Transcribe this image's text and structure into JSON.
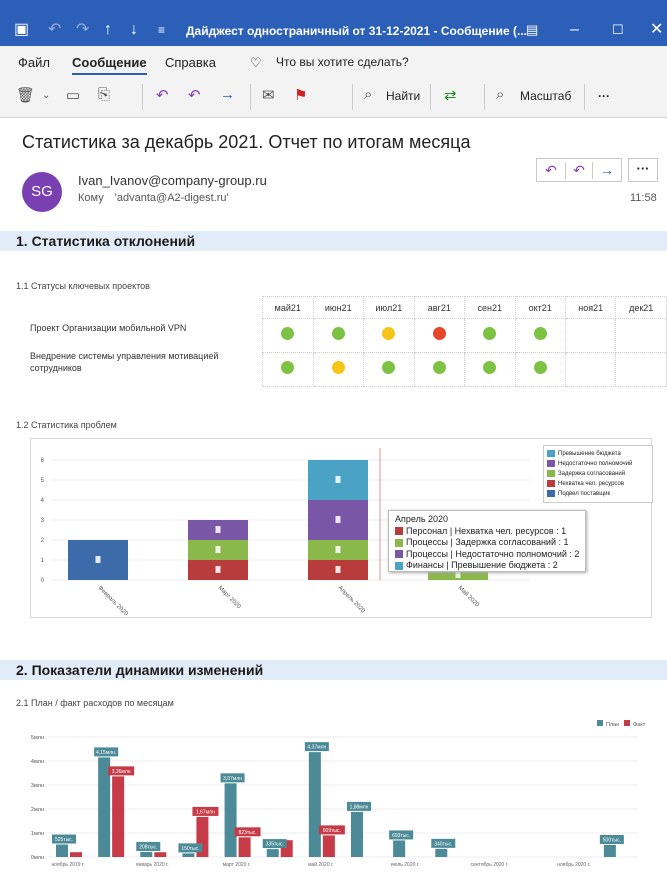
{
  "window": {
    "title": "Дайджест одностраничный от 31-12-2021 - Сообщение (..."
  },
  "menu": {
    "items": [
      "Файл",
      "Сообщение",
      "Справка"
    ],
    "tell_me": "Что вы хотите сделать?"
  },
  "ribbon": {
    "find": "Найти",
    "zoom": "Масштаб",
    "more": "···"
  },
  "message": {
    "subject": "Статистика за декабрь 2021. Отчет по итогам месяца",
    "avatar_initials": "SG",
    "sender": "Ivan_Ivanov@company-group.ru",
    "to_label": "Кому",
    "to_value": "'advanta@A2-digest.ru'",
    "time": "11:58"
  },
  "section1": {
    "title": "1. Статистика отклонений",
    "sub1": "1.1 Статусы ключевых проектов",
    "sub2": "1.2 Статистика проблем"
  },
  "status_table": {
    "months": [
      "май21",
      "июн21",
      "июл21",
      "авг21",
      "сен21",
      "окт21",
      "ноя21",
      "дек21"
    ],
    "projects": [
      {
        "name": "Проект Организации мобильной VPN",
        "statuses": [
          "green",
          "green",
          "yellow",
          "red",
          "green",
          "green",
          "",
          ""
        ]
      },
      {
        "name": "Внедрение системы управления мотивацией сотрудников",
        "statuses": [
          "green",
          "yellow",
          "green",
          "green",
          "green",
          "green",
          "",
          ""
        ]
      }
    ],
    "colors": {
      "green": "#7dc242",
      "yellow": "#f5c518",
      "red": "#e8462a"
    }
  },
  "chart_data": [
    {
      "type": "bar",
      "stacked": true,
      "categories": [
        "Февраль 2020",
        "Март 2020",
        "Апрель 2020",
        "Май 2020"
      ],
      "ylim": [
        0,
        6
      ],
      "yticks": [
        0,
        1,
        2,
        3,
        4,
        5,
        6
      ],
      "series": [
        {
          "name": "Превышение бюджета",
          "color": "#4aa3c5",
          "values": [
            0,
            0,
            2,
            0
          ]
        },
        {
          "name": "Недостаточно полномочий",
          "color": "#7a57a6",
          "values": [
            0,
            1,
            2,
            0
          ]
        },
        {
          "name": "Задержка согласований",
          "color": "#8ab84a",
          "values": [
            0,
            1,
            1,
            0.5
          ]
        },
        {
          "name": "Нехватка чел. ресурсов",
          "color": "#b83c3c",
          "values": [
            0,
            1,
            1,
            0
          ]
        },
        {
          "name": "Подвел поставщик",
          "color": "#3d6aa8",
          "values": [
            2,
            0,
            0,
            0
          ]
        }
      ],
      "tooltip": {
        "title": "Апрель 2020",
        "lines": [
          {
            "text": "Персонал | Нехватка чел. ресурсов : 1",
            "color": "#b83c3c"
          },
          {
            "text": "Процессы | Задержка согласований : 1",
            "color": "#8ab84a"
          },
          {
            "text": "Процессы | Недостаточно полномочий : 2",
            "color": "#7a57a6"
          },
          {
            "text": "Финансы | Превышение бюджета : 2",
            "color": "#4aa3c5"
          }
        ]
      }
    },
    {
      "type": "bar",
      "title": "2.1 План / факт расходов по месяцам",
      "legend": [
        "План",
        "Факт"
      ],
      "colors": [
        "#4b8a96",
        "#c63b47"
      ],
      "ylim": [
        0,
        5
      ],
      "ytick_labels": [
        "0млн",
        "1млн",
        "2млн",
        "3млн",
        "4млн",
        "5млн"
      ],
      "x_tick_labels": [
        "ноябрь 2019 г.",
        "январь 2020 г.",
        "март 2020 г.",
        "май 2020 г.",
        "июль 2020 г.",
        "сентябрь 2020 г.",
        "ноябрь 2020 г."
      ],
      "groups": [
        {
          "plan": 0.52,
          "fact": 0.2,
          "plan_label": "525тыс.",
          "fact_label": ""
        },
        {
          "plan": 4.15,
          "fact": 3.36,
          "plan_label": "4,15млн.",
          "fact_label": "3,36млн"
        },
        {
          "plan": 0.21,
          "fact": 0.2,
          "plan_label": "208тыс.",
          "fact_label": ""
        },
        {
          "plan": 0.15,
          "fact": 1.67,
          "plan_label": "150тыс.",
          "fact_label": "1,67млн"
        },
        {
          "plan": 3.07,
          "fact": 0.82,
          "plan_label": "3,07млн",
          "fact_label": "823тыс."
        },
        {
          "plan": 0.33,
          "fact": 0.7,
          "plan_label": "335тыс.",
          "fact_label": ""
        },
        {
          "plan": 4.37,
          "fact": 0.9,
          "plan_label": "4,37млн",
          "fact_label": "909тыс."
        },
        {
          "plan": 1.88,
          "fact": 0,
          "plan_label": "1,88млн",
          "fact_label": ""
        },
        {
          "plan": 0.69,
          "fact": 0,
          "plan_label": "693тыс.",
          "fact_label": ""
        },
        {
          "plan": 0.34,
          "fact": 0,
          "plan_label": "340тыс.",
          "fact_label": ""
        },
        {
          "plan": 0,
          "fact": 0,
          "plan_label": "",
          "fact_label": ""
        },
        {
          "plan": 0,
          "fact": 0,
          "plan_label": "",
          "fact_label": ""
        },
        {
          "plan": 0,
          "fact": 0,
          "plan_label": "",
          "fact_label": ""
        },
        {
          "plan": 0.5,
          "fact": 0,
          "plan_label": "500тыс.",
          "fact_label": ""
        }
      ]
    }
  ],
  "section2": {
    "title": "2. Показатели динамики изменений",
    "sub1": "2.1 План / факт расходов по месяцам"
  }
}
